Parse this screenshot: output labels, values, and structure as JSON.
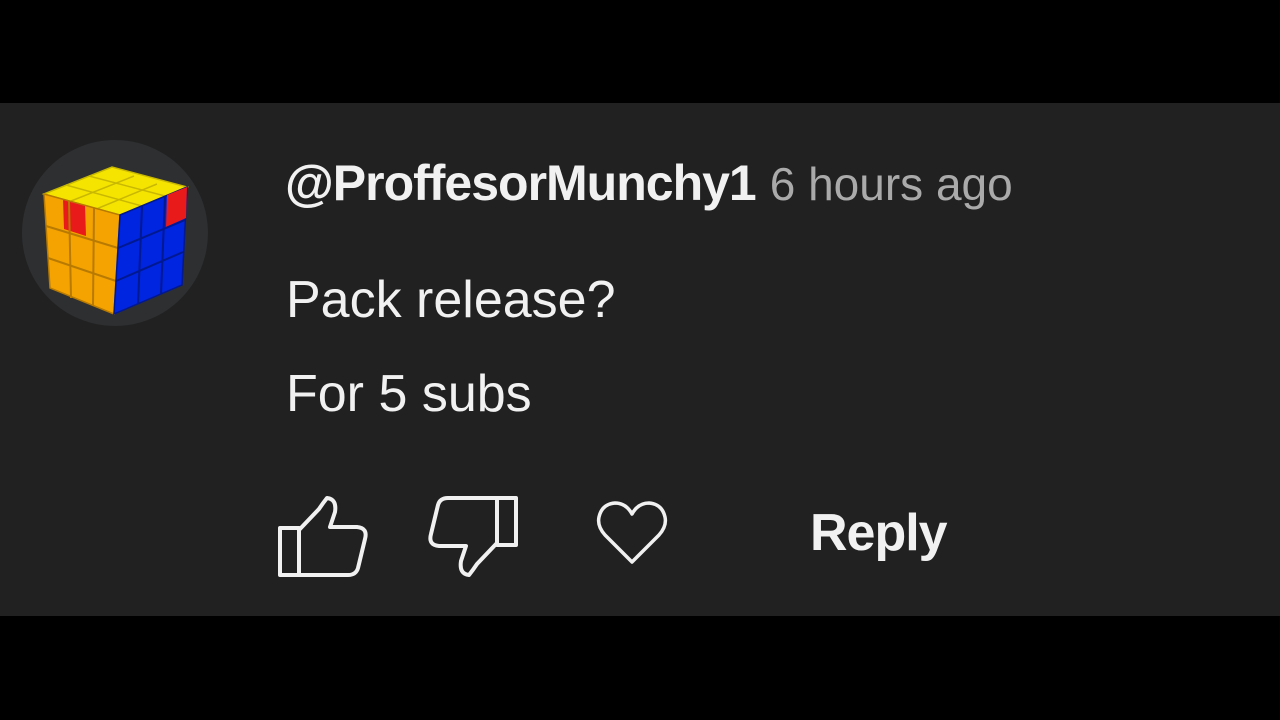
{
  "comment": {
    "author": "@ProffesorMunchy1",
    "timestamp": "6 hours ago",
    "lines": [
      "Pack release?",
      "For 5 subs"
    ]
  },
  "avatar": {
    "icon": "rubiks-cube-icon",
    "colors": {
      "top": "#f5e400",
      "left": "#f5a300",
      "right": "#0025e0",
      "accent": "#e81a1a"
    }
  },
  "actions": {
    "like_icon": "thumbs-up-icon",
    "dislike_icon": "thumbs-down-icon",
    "heart_icon": "heart-icon",
    "reply_label": "Reply"
  },
  "theme": {
    "page_background": "#000000",
    "card_background": "#212121",
    "text_primary": "#f1f1f1",
    "text_secondary": "#aaaaaa"
  }
}
